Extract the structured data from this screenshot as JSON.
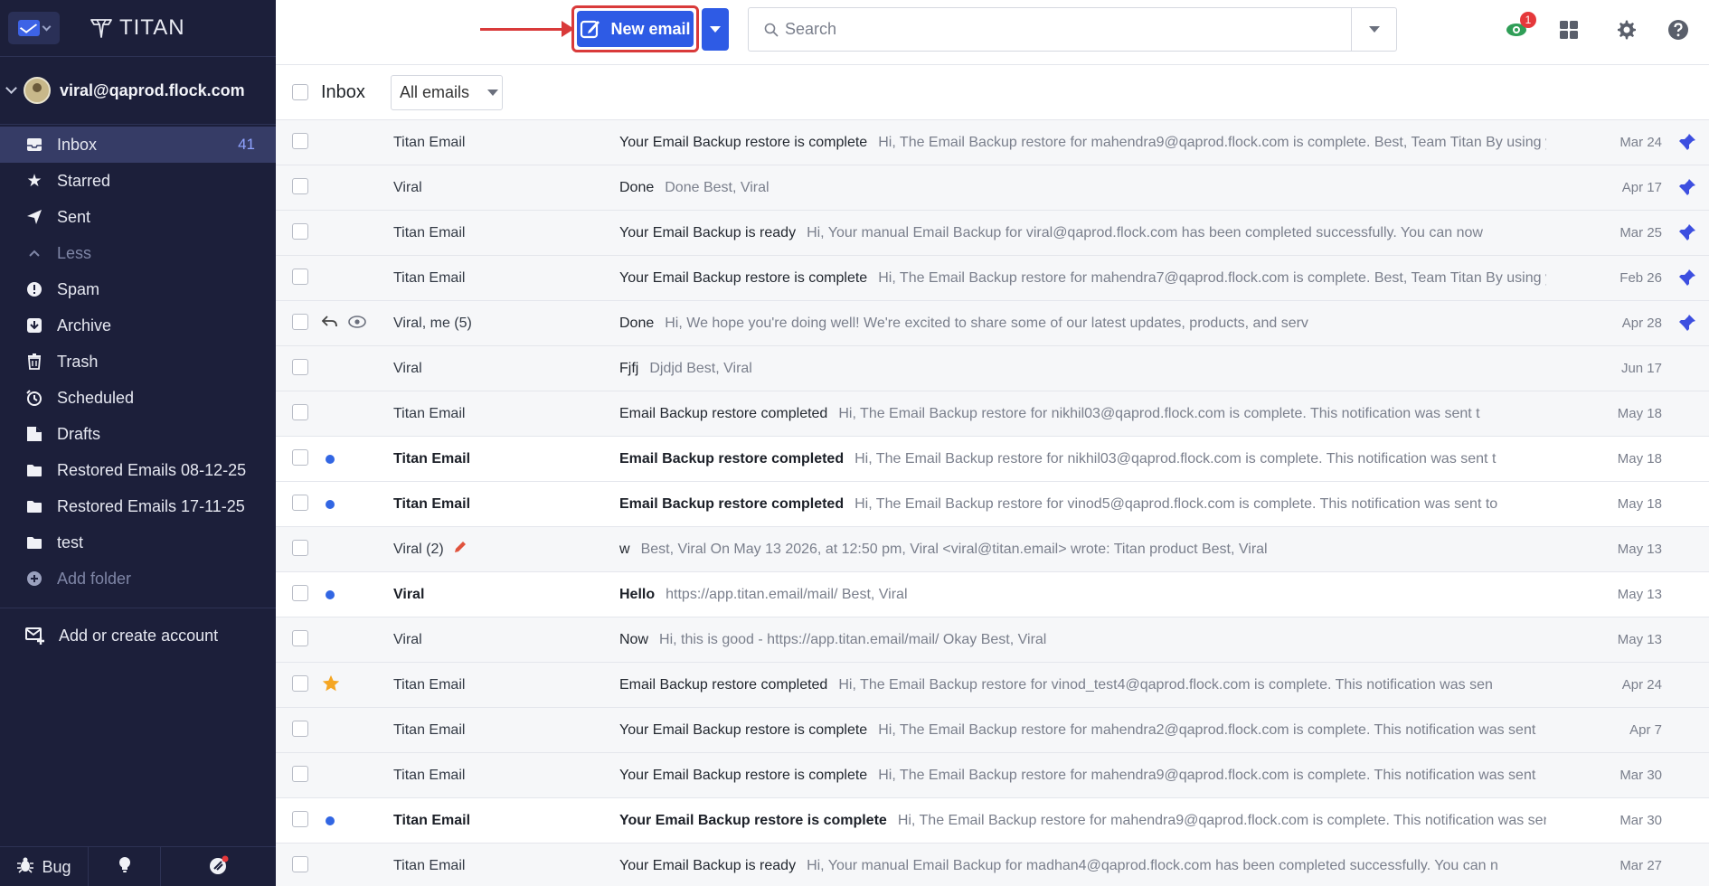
{
  "app": {
    "brand": "TITAN"
  },
  "account": {
    "email": "viral@qaprod.flock.com"
  },
  "sidebar": {
    "folders": [
      {
        "label": "Inbox",
        "icon": "inbox-icon",
        "count": "41",
        "active": true
      },
      {
        "label": "Starred",
        "icon": "star-icon"
      },
      {
        "label": "Sent",
        "icon": "send-icon"
      },
      {
        "label": "Less",
        "icon": "chevron-up-icon",
        "muted": true
      },
      {
        "label": "Spam",
        "icon": "spam-icon"
      },
      {
        "label": "Archive",
        "icon": "archive-icon"
      },
      {
        "label": "Trash",
        "icon": "trash-icon"
      },
      {
        "label": "Scheduled",
        "icon": "scheduled-icon"
      },
      {
        "label": "Drafts",
        "icon": "drafts-icon"
      },
      {
        "label": "Restored Emails 08-12-25",
        "icon": "folder-icon"
      },
      {
        "label": "Restored Emails 17-11-25",
        "icon": "folder-icon"
      },
      {
        "label": "test",
        "icon": "folder-icon"
      },
      {
        "label": "Add folder",
        "icon": "add-folder-icon",
        "muted": true
      }
    ],
    "add_account": "Add or create account",
    "bottom": {
      "bug_label": "Bug"
    }
  },
  "toolbar": {
    "new_email_label": "New email",
    "search_placeholder": "Search",
    "notif_count": "1"
  },
  "list": {
    "title": "Inbox",
    "filter": "All emails"
  },
  "emails": [
    {
      "sender": "Titan Email",
      "subject": "Your Email Backup restore is complete",
      "snippet": "Hi, The Email Backup restore for mahendra9@qaprod.flock.com is complete. Best, Team Titan By using y",
      "date": "Mar 24",
      "pinned": true
    },
    {
      "sender": "Viral",
      "subject": "Done",
      "snippet": "Done Best, Viral",
      "date": "Apr 17",
      "pinned": true
    },
    {
      "sender": "Titan Email",
      "subject": "Your Email Backup is ready",
      "snippet": "Hi, Your manual Email Backup for viral@qaprod.flock.com has been completed successfully. You can now",
      "date": "Mar 25",
      "pinned": true
    },
    {
      "sender": "Titan Email",
      "subject": "Your Email Backup restore is complete",
      "snippet": "Hi, The Email Backup restore for mahendra7@qaprod.flock.com is complete. Best, Team Titan By using y",
      "date": "Feb 26",
      "pinned": true
    },
    {
      "sender": "Viral, me (5)",
      "subject": "Done",
      "snippet": "Hi, We hope you're doing well! We're excited to share some of our latest updates, products, and serv",
      "date": "Apr 28",
      "pinned": true,
      "replied": true,
      "seen": true
    },
    {
      "sender": "Viral",
      "subject": "Fjfj",
      "snippet": "Djdjd Best, Viral",
      "date": "Jun 17"
    },
    {
      "sender": "Titan Email",
      "subject": "Email Backup restore completed",
      "snippet": "Hi, The Email Backup restore for nikhil03@qaprod.flock.com is complete. This notification was sent t",
      "date": "May 18"
    },
    {
      "sender": "Titan Email",
      "subject": "Email Backup restore completed",
      "snippet": "Hi, The Email Backup restore for nikhil03@qaprod.flock.com is complete. This notification was sent t",
      "date": "May 18",
      "unread": true
    },
    {
      "sender": "Titan Email",
      "subject": "Email Backup restore completed",
      "snippet": "Hi, The Email Backup restore for vinod5@qaprod.flock.com is complete. This notification was sent to",
      "date": "May 18",
      "unread": true
    },
    {
      "sender": "Viral (2)",
      "subject": "w",
      "snippet": "Best, Viral On May 13 2026, at 12:50 pm, Viral <viral@titan.email> wrote: Titan product Best, Viral",
      "date": "May 13",
      "draft": true
    },
    {
      "sender": "Viral",
      "subject": "Hello",
      "snippet": "https://app.titan.email/mail/ Best, Viral",
      "date": "May 13",
      "unread": true
    },
    {
      "sender": "Viral",
      "subject": "Now",
      "snippet": "Hi, this is good - https://app.titan.email/mail/ Okay Best, Viral",
      "date": "May 13"
    },
    {
      "sender": "Titan Email",
      "subject": "Email Backup restore completed",
      "snippet": "Hi, The Email Backup restore for vinod_test4@qaprod.flock.com is complete. This notification was sen",
      "date": "Apr 24",
      "starred": true
    },
    {
      "sender": "Titan Email",
      "subject": "Your Email Backup restore is complete",
      "snippet": "Hi, The Email Backup restore for mahendra2@qaprod.flock.com is complete. This notification was sent",
      "date": "Apr 7"
    },
    {
      "sender": "Titan Email",
      "subject": "Your Email Backup restore is complete",
      "snippet": "Hi, The Email Backup restore for mahendra9@qaprod.flock.com is complete. This notification was sent",
      "date": "Mar 30"
    },
    {
      "sender": "Titan Email",
      "subject": "Your Email Backup restore is complete",
      "snippet": "Hi, The Email Backup restore for mahendra9@qaprod.flock.com is complete. This notification was sent",
      "date": "Mar 30",
      "unread": true
    },
    {
      "sender": "Titan Email",
      "subject": "Your Email Backup is ready",
      "snippet": "Hi, Your manual Email Backup for madhan4@qaprod.flock.com has been completed successfully. You can n",
      "date": "Mar 27"
    }
  ],
  "colors": {
    "sidebar_bg": "#1c1f3a",
    "accent": "#2e5be5",
    "highlight": "#d93a3a",
    "unread_dot": "#3266e3",
    "pin": "#3d4fe0",
    "star": "#f5a623"
  }
}
